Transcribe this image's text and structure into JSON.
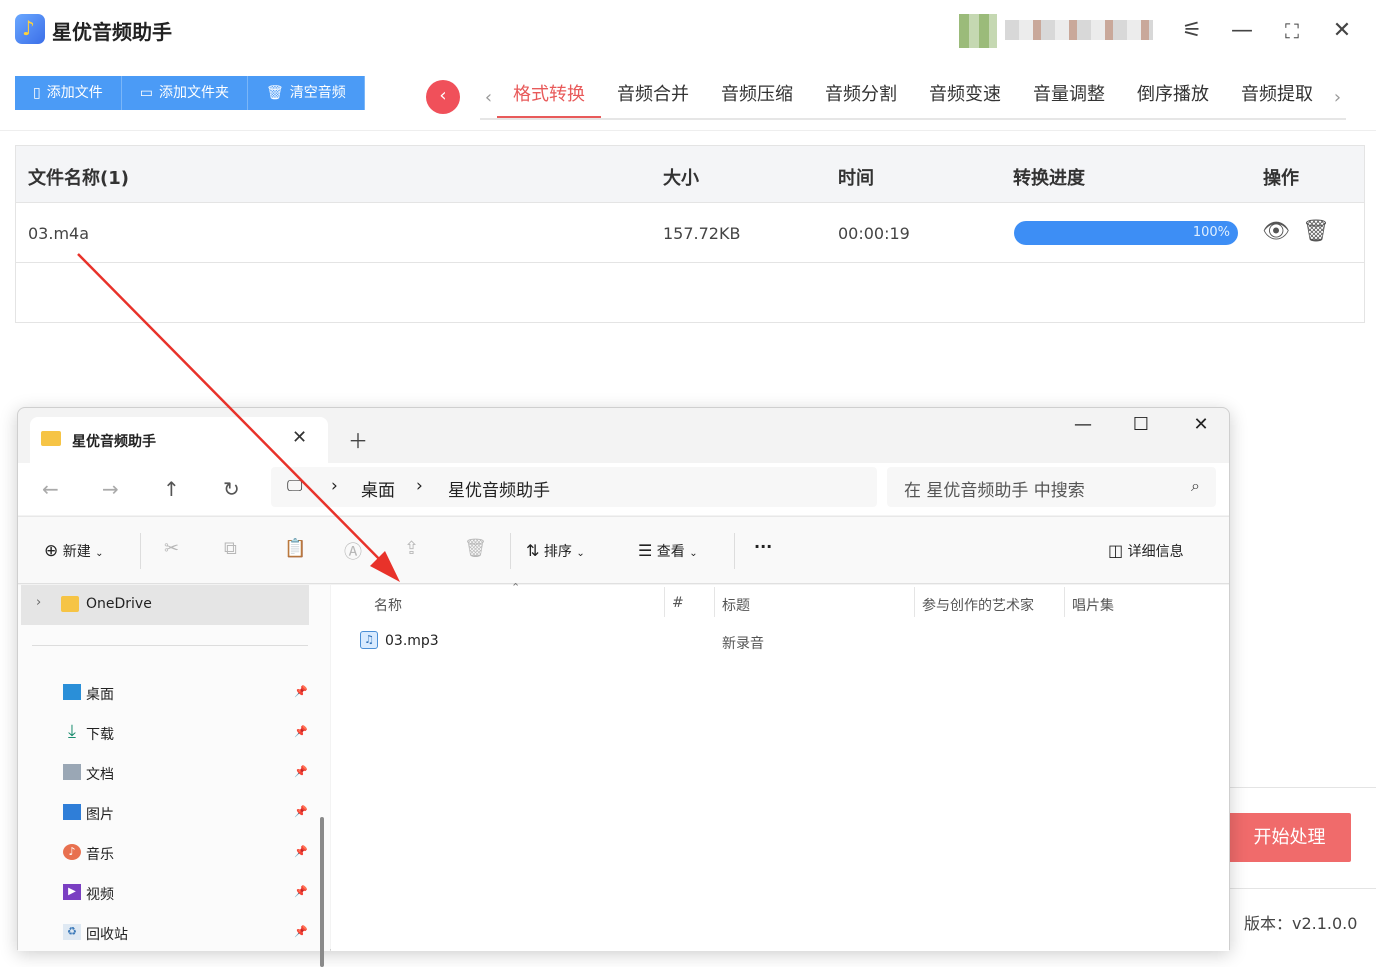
{
  "app": {
    "title": "星优音频助手",
    "toolbar": {
      "add_file": "添加文件",
      "add_folder": "添加文件夹",
      "clear": "清空音频"
    },
    "tabs": [
      "格式转换",
      "音频合并",
      "音频压缩",
      "音频分割",
      "音频变速",
      "音量调整",
      "倒序播放",
      "音频提取"
    ],
    "active_tab": "格式转换",
    "table": {
      "headers": {
        "name": "文件名称(1)",
        "size": "大小",
        "time": "时间",
        "progress": "转换进度",
        "ops": "操作"
      },
      "rows": [
        {
          "name": "03.m4a",
          "size": "157.72KB",
          "time": "00:00:19",
          "progress": "100%",
          "progress_value": 1.0
        }
      ]
    },
    "start_button": "开始处理",
    "version": "版本：v2.1.0.0"
  },
  "explorer": {
    "tab_title": "星优音频助手",
    "breadcrumb": [
      "桌面",
      "星优音频助手"
    ],
    "search_placeholder": "在 星优音频助手 中搜索",
    "commands": {
      "new": "新建",
      "sort": "排序",
      "view": "查看",
      "more": "···",
      "details": "详细信息"
    },
    "sidebar": {
      "onedrive": "OneDrive",
      "items": [
        {
          "label": "桌面",
          "icon": "desktop-icon"
        },
        {
          "label": "下载",
          "icon": "download-icon"
        },
        {
          "label": "文档",
          "icon": "document-icon"
        },
        {
          "label": "图片",
          "icon": "picture-icon"
        },
        {
          "label": "音乐",
          "icon": "music-icon"
        },
        {
          "label": "视频",
          "icon": "video-icon"
        },
        {
          "label": "回收站",
          "icon": "recycle-bin-icon"
        }
      ]
    },
    "columns": {
      "name": "名称",
      "num": "#",
      "title": "标题",
      "artist": "参与创作的艺术家",
      "album": "唱片集"
    },
    "files": [
      {
        "name": "03.mp3",
        "title": "新录音"
      }
    ]
  },
  "colors": {
    "accent_blue": "#4b9bf6",
    "accent_red": "#e85a5a",
    "progress": "#3d8ef5",
    "start_button": "#f06b6b"
  }
}
